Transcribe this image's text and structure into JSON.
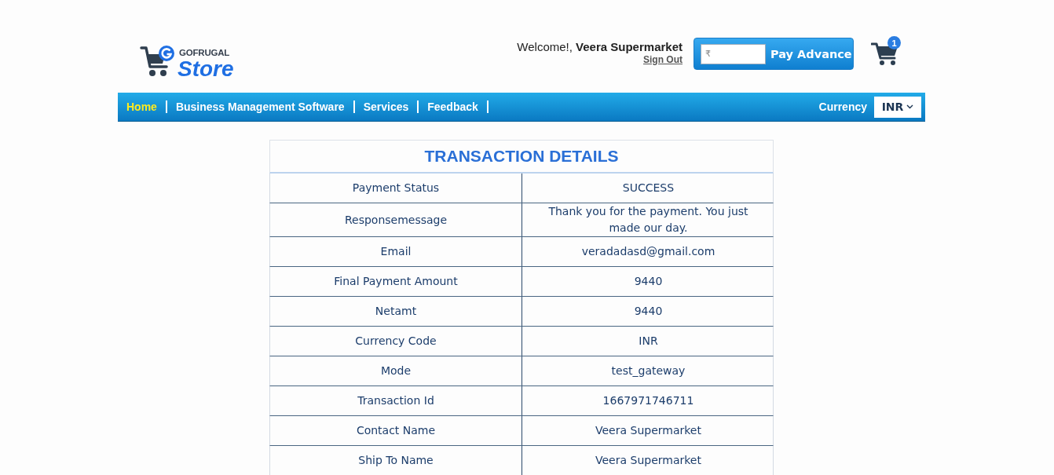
{
  "header": {
    "logo": {
      "brand": "GOFRUGAL",
      "product": "Store"
    },
    "welcome": {
      "text": "Welcome!, **Veera Supermarket**",
      "sign_out": "Sign Out"
    },
    "pay_advance": {
      "placeholder": "₹",
      "button": "Pay Advance"
    },
    "cart": {
      "count": "1"
    }
  },
  "nav": {
    "items": [
      {
        "label": "Home",
        "selected": true
      },
      {
        "label": "Business Management Software",
        "selected": false
      },
      {
        "label": "Services",
        "selected": false
      },
      {
        "label": "Feedback",
        "selected": false
      }
    ],
    "currency": {
      "label": "Currency",
      "value": "INR"
    }
  },
  "transaction": {
    "title": "TRANSACTION DETAILS",
    "rows": [
      {
        "label": "Payment Status",
        "value": "SUCCESS"
      },
      {
        "label": "Responsemessage",
        "value": "Thank you for the payment. You just made our day."
      },
      {
        "label": "Email",
        "value": "veradadasd@gmail.com"
      },
      {
        "label": "Final Payment Amount",
        "value": "9440"
      },
      {
        "label": "Netamt",
        "value": "9440"
      },
      {
        "label": "Currency Code",
        "value": "INR"
      },
      {
        "label": "Mode",
        "value": "test_gateway"
      },
      {
        "label": "Transaction Id",
        "value": "1667971746711"
      },
      {
        "label": "Contact Name",
        "value": "Veera Supermarket"
      },
      {
        "label": "Ship To Name",
        "value": "Veera Supermarket"
      }
    ]
  }
}
